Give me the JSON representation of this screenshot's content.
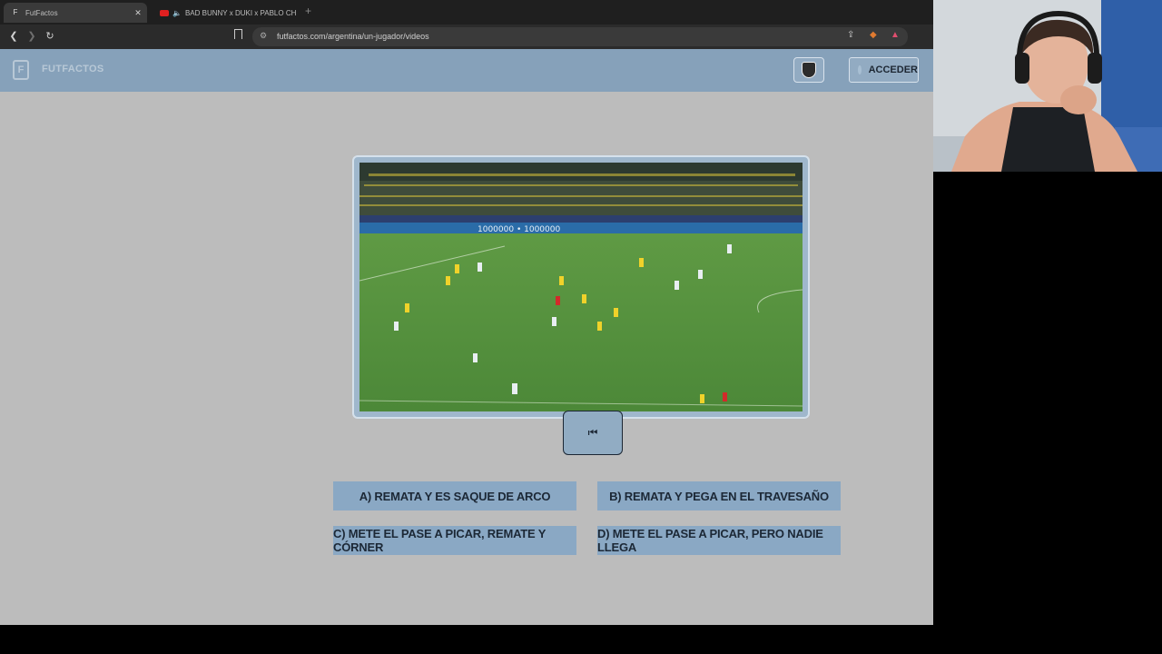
{
  "browser": {
    "tabs": [
      {
        "title": "FutFactos",
        "favicon": "futfactos-favicon",
        "active": true
      },
      {
        "title": "BAD BUNNY x DUKI x PABLO CH",
        "favicon": "youtube-favicon",
        "active": false
      }
    ],
    "url": "futfactos.com/argentina/un-jugador/videos"
  },
  "site": {
    "logo_text": "FUTFACTOS",
    "login_label": "ACCEDER",
    "team_badge_icon": "shield-icon"
  },
  "quiz": {
    "video_alt": "Brazil vs Argentina match clip",
    "replay_icon": "rewind-icon",
    "replay_glyph": "⏮",
    "options": [
      {
        "label": "A) REMATA Y ES SAQUE DE ARCO"
      },
      {
        "label": "B) REMATA Y PEGA EN EL TRAVESAÑO"
      },
      {
        "label": "C) METE EL PASE A PICAR, REMATE Y CÓRNER"
      },
      {
        "label": "D) METE EL PASE A PICAR, PERO NADIE LLEGA"
      }
    ]
  },
  "colors": {
    "header_bg": "#86a1ba",
    "button_bg": "#8aa8c4",
    "page_bg": "#bcbcbc"
  }
}
